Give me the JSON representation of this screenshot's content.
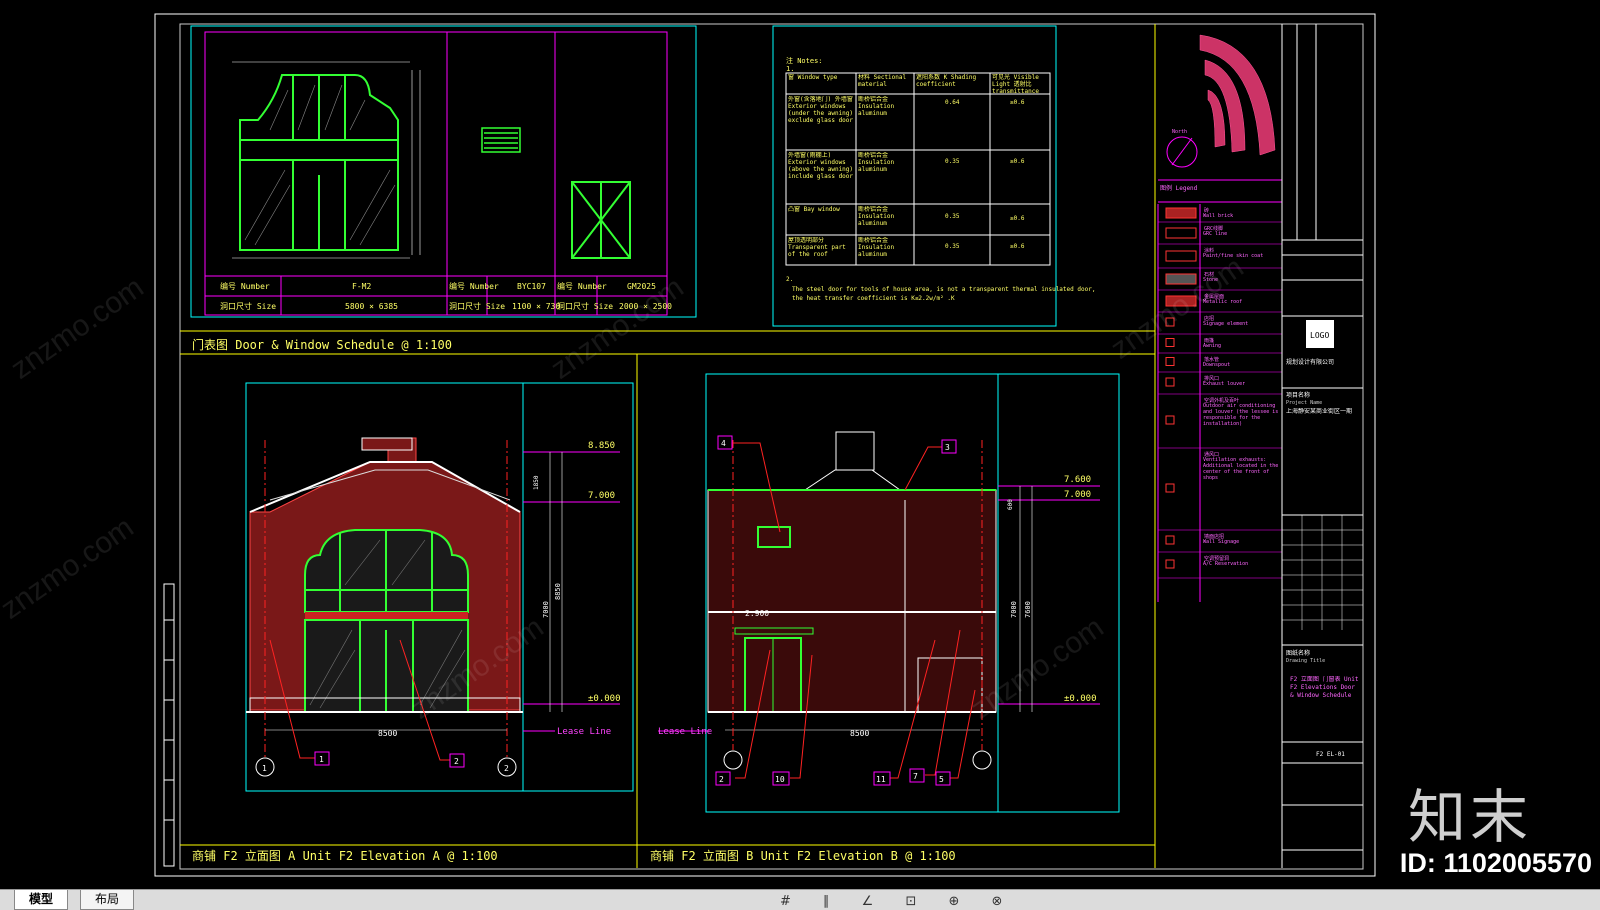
{
  "drawing": {
    "schedule_title": "门表图 Door & Window Schedule @ 1:100",
    "elev_a_title": "商铺 F2 立面图 A Unit F2 Elevation A @ 1:100",
    "elev_b_title": "商铺 F2 立面图 B Unit F2 Elevation B @ 1:100",
    "door_table": {
      "rows": [
        {
          "label": "编号 Number",
          "v1": "F-M2",
          "l2": "编号 Number",
          "v2": "BYC107",
          "l3": "编号 Number",
          "v3": "GM2025"
        },
        {
          "label": "洞口尺寸 Size",
          "v1": "5800 × 6385",
          "l2": "洞口尺寸 Size",
          "v2": "1100 × 730",
          "l3": "洞口尺寸 Size",
          "v3": "2000 × 2500"
        }
      ]
    },
    "notes_heading": "注 Notes:",
    "notes_sub": "1.",
    "window_table": {
      "headers": [
        "窗 Window type",
        "材料 Sectional material",
        "遮阳系数 K Shading coefficient",
        "可见光 Visible Light 透射比 transmittance"
      ],
      "rows": [
        {
          "type": "外窗(含落地门) 外墙窗 Exterior windows (under the awning) exclude glass door",
          "mat": "断桥铝合金 Insulation aluminum",
          "k": "0.64",
          "t": "≥0.6"
        },
        {
          "type": "外墙窗(雨棚上) Exterior windows (above the awning) include glass door",
          "mat": "断桥铝合金 Insulation aluminum",
          "k": "0.35",
          "t": "≥0.6"
        },
        {
          "type": "凸窗 Bay window",
          "mat": "断桥铝合金 Insulation aluminum",
          "k": "0.35",
          "t": "≥0.6"
        },
        {
          "type": "屋顶透明部分 Transparent part of the roof",
          "mat": "断桥铝合金 Insulation aluminum",
          "k": "0.35",
          "t": "≥0.6"
        }
      ]
    },
    "notes_footer": [
      "2.",
      "The steel door for tools of house area, is not a transparent thermal insulated door,",
      "the heat transfer coefficient is K≤2.2w/m² .K"
    ],
    "elevation_a": {
      "levels": [
        "8.850",
        "7.000",
        "±0.000"
      ],
      "width_dim": "8500",
      "dims_v": [
        "1850",
        "7000",
        "8850"
      ],
      "lease_line": "Lease Line",
      "tags": [
        "1",
        "2"
      ],
      "grid_marks": [
        "1",
        "2"
      ]
    },
    "elevation_b": {
      "levels": [
        "7.600",
        "7.000",
        "±0.000"
      ],
      "mid_level": "2.900",
      "width_dim": "8500",
      "dims_v": [
        "600",
        "7000",
        "7600"
      ],
      "lease_line": "Lease Line",
      "tags": [
        "4",
        "3",
        "2",
        "10",
        "11",
        "7",
        "5"
      ]
    },
    "legend": {
      "title": "图例 Legend",
      "items": [
        {
          "cn": "砖",
          "en": "Wall brick"
        },
        {
          "cn": "GRC线脚",
          "en": "GRC line"
        },
        {
          "cn": "涂料",
          "en": "Paint/fine skin coat"
        },
        {
          "cn": "石材",
          "en": "Stone"
        },
        {
          "cn": "金属屋面",
          "en": "Metallic roof"
        },
        {
          "cn": "店招",
          "en": "Signage element"
        },
        {
          "cn": "雨篷",
          "en": "Awning"
        },
        {
          "cn": "落水管",
          "en": "Downspout"
        },
        {
          "cn": "排风口",
          "en": "Exhaust louver"
        },
        {
          "cn": "空调外机及百叶",
          "en": "Outdoor air conditioning and louver (the lessee is responsible for the installation)"
        },
        {
          "cn": "通风口",
          "en": "Ventilation exhausts: Additional located in the center of the front of shops"
        },
        {
          "cn": "墙面店招",
          "en": "Wall Signage"
        },
        {
          "cn": "空调预留洞",
          "en": "A/C Reservation"
        }
      ]
    },
    "title_block": {
      "project_label": "项目名称",
      "project_en": "Project Name",
      "project_name": "上海静安某商业街区一期",
      "drawing_label": "图纸名称",
      "drawing_en": "Drawing Title",
      "drawing_name": "F2 立面图 门窗表 Unit F2 Elevations Door & Window Schedule",
      "sheet_no": "F2 EL-01",
      "company": "规划设计有限公司"
    },
    "compass": "North"
  },
  "tabs": [
    {
      "label": "模型",
      "active": true
    },
    {
      "label": "布局",
      "active": false
    }
  ],
  "watermark": {
    "logo": "知末",
    "id": "ID: 1102005570",
    "diag": "znzmo.com"
  },
  "status_glyphs": "# ∥ ∠ ⊡ ⊕ ⊗",
  "colors": {
    "frame": "#ffffff",
    "cyan": "#00ffff",
    "magenta": "#ff00ff",
    "yellow": "#ffff00",
    "green": "#33ff33",
    "brick": "#8b1a1a",
    "red": "#ff2222"
  }
}
